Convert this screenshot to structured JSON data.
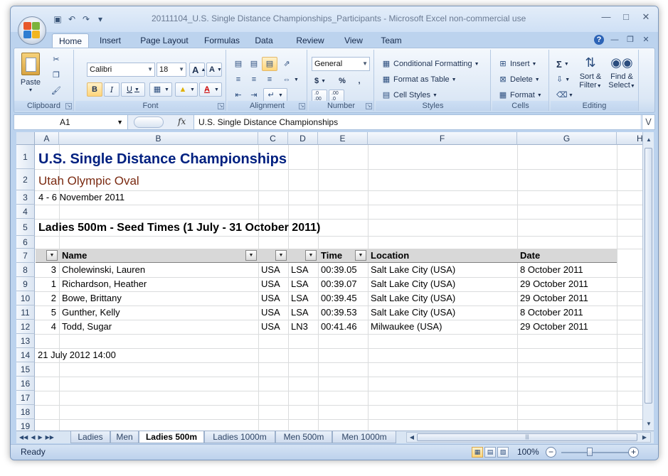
{
  "window": {
    "title": "20111104_U.S. Single Distance Championships_Participants - Microsoft Excel non-commercial use"
  },
  "tabs": [
    "Home",
    "Insert",
    "Page Layout",
    "Formulas",
    "Data",
    "Review",
    "View",
    "Team"
  ],
  "ribbon": {
    "clipboard": {
      "label": "Clipboard",
      "paste": "Paste"
    },
    "font": {
      "label": "Font",
      "name": "Calibri",
      "size": "18",
      "bold": "B",
      "italic": "I",
      "underline": "U"
    },
    "alignment": {
      "label": "Alignment"
    },
    "number": {
      "label": "Number",
      "format": "General",
      "currency": "$",
      "percent": "%",
      "comma": ",",
      "inc_dec": ".0 .00",
      "dec_dec": ".00 .0"
    },
    "styles": {
      "label": "Styles",
      "conditional": "Conditional Formatting",
      "table": "Format as Table",
      "cell_styles": "Cell Styles"
    },
    "cells": {
      "label": "Cells",
      "insert": "Insert",
      "delete": "Delete",
      "format": "Format"
    },
    "editing": {
      "label": "Editing",
      "sum": "Σ",
      "sort_line1": "Sort &",
      "sort_line2": "Filter",
      "find_line1": "Find &",
      "find_line2": "Select"
    }
  },
  "formula_bar": {
    "cell_ref": "A1",
    "fx": "fx",
    "content": "U.S. Single Distance Championships"
  },
  "columns": [
    "A",
    "B",
    "C",
    "D",
    "E",
    "F",
    "G",
    "H"
  ],
  "rows": [
    "1",
    "2",
    "3",
    "4",
    "5",
    "6",
    "7",
    "8",
    "9",
    "10",
    "11",
    "12",
    "13",
    "14",
    "15",
    "16",
    "17",
    "18",
    "19"
  ],
  "sheet": {
    "title": "U.S. Single Distance Championships",
    "venue": "Utah Olympic Oval",
    "dates": "4 - 6 November 2011",
    "subtitle": "Ladies 500m - Seed Times (1 July - 31 October 2011)",
    "headers": {
      "name": "Name",
      "time": "Time",
      "location": "Location",
      "date": "Date"
    },
    "entries": [
      {
        "seed": "3",
        "name": "Cholewinski, Lauren",
        "country": "USA",
        "club": "LSA",
        "time": "00:39.05",
        "location": "Salt Lake City (USA)",
        "date": "8 October 2011"
      },
      {
        "seed": "1",
        "name": "Richardson, Heather",
        "country": "USA",
        "club": "LSA",
        "time": "00:39.07",
        "location": "Salt Lake City (USA)",
        "date": "29 October 2011"
      },
      {
        "seed": "2",
        "name": "Bowe, Brittany",
        "country": "USA",
        "club": "LSA",
        "time": "00:39.45",
        "location": "Salt Lake City (USA)",
        "date": "29 October 2011"
      },
      {
        "seed": "5",
        "name": "Gunther, Kelly",
        "country": "USA",
        "club": "LSA",
        "time": "00:39.53",
        "location": "Salt Lake City (USA)",
        "date": "8 October 2011"
      },
      {
        "seed": "4",
        "name": "Todd, Sugar",
        "country": "USA",
        "club": "LN3",
        "time": "00:41.46",
        "location": "Milwaukee (USA)",
        "date": "29 October 2011"
      }
    ],
    "timestamp": "21 July 2012  14:00"
  },
  "sheet_tabs": [
    "Ladies",
    "Men",
    "Ladies 500m",
    "Ladies 1000m",
    "Men 500m",
    "Men 1000m"
  ],
  "status": {
    "text": "Ready",
    "zoom": "100%"
  },
  "colors": {
    "title_blue": "#002080",
    "venue_red": "#7b2b12"
  }
}
